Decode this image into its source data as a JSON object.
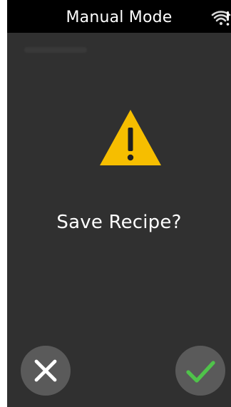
{
  "header": {
    "title": "Manual Mode",
    "wifi_icon": "wifi-alert-icon"
  },
  "dialog": {
    "warning_icon": "warning-icon",
    "prompt": "Save Recipe?"
  },
  "actions": {
    "cancel_icon": "close-icon",
    "confirm_icon": "checkmark-icon"
  },
  "colors": {
    "background": "#303030",
    "status_bar": "#000000",
    "warning": "#f6be00",
    "button_bg": "#5a5a5a",
    "confirm_check": "#4fc34a",
    "cancel_x": "#ffffff"
  }
}
